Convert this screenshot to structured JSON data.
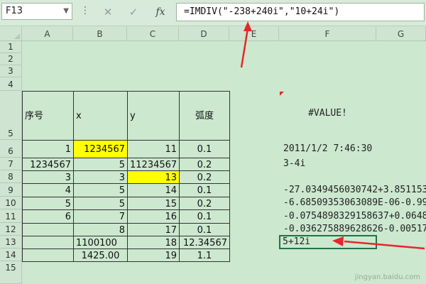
{
  "formula_bar": {
    "name_box": "F13",
    "formula": "=IMDIV(\"-238+240i\",\"10+24i\")",
    "cancel_glyph": "✕",
    "enter_glyph": "✓",
    "fx_label": "fx"
  },
  "columns": [
    "A",
    "B",
    "C",
    "D",
    "E",
    "F",
    "G"
  ],
  "rows": [
    "1",
    "2",
    "3",
    "4",
    "5",
    "6",
    "7",
    "8",
    "9",
    "10",
    "11",
    "12",
    "13",
    "14",
    "15"
  ],
  "table": {
    "headers": {
      "a": "序号",
      "b": "x",
      "c": "y",
      "d": "弧度"
    },
    "r6": {
      "a": "1",
      "b": "1234567",
      "c": "11",
      "d": "0.1"
    },
    "r7": {
      "a": "1234567",
      "b": "5",
      "c": "11234567",
      "d": "0.2"
    },
    "r8": {
      "a": "3",
      "b": "3",
      "c": "13",
      "d": "0.2"
    },
    "r9": {
      "a": "4",
      "b": "5",
      "c": "14",
      "d": "0.1"
    },
    "r10": {
      "a": "5",
      "b": "5",
      "c": "15",
      "d": "0.2"
    },
    "r11": {
      "a": "6",
      "b": "7",
      "c": "16",
      "d": "0.1"
    },
    "r12": {
      "a": "",
      "b": "8",
      "c": "17",
      "d": "0.1"
    },
    "r13": {
      "a": "",
      "b": "1100100",
      "c": "18",
      "d": "12.34567"
    },
    "r14": {
      "a": "",
      "b": "1425.00",
      "c": "19",
      "d": "1.1"
    }
  },
  "column_f": {
    "r5": "#VALUE!",
    "r6": "2011/1/2 7:46:30",
    "r7": "3-4i",
    "r9": "-27.0349456030742+3.851153",
    "r10": "-6.68509353063089E-06-0.99",
    "r11": "-0.0754898329158637+0.0648",
    "r12": "-0.036275889628626-0.00517",
    "r13": "5+12i"
  },
  "watermark": "jingyan.baidu.com",
  "colors": {
    "sheet_bg": "#cce8cf",
    "highlight": "#ffff00",
    "selection": "#217346",
    "arrow": "#e8262a"
  }
}
